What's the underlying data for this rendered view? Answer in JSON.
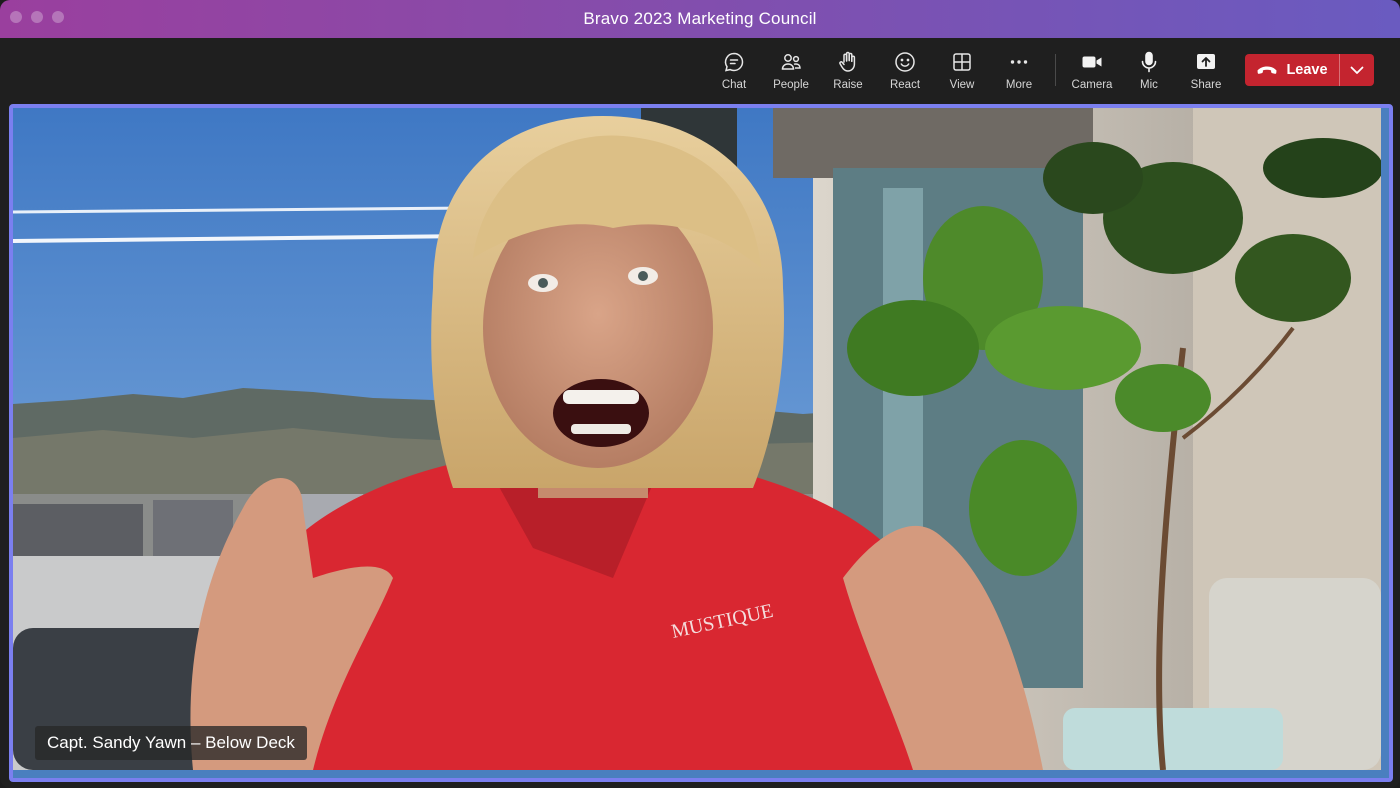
{
  "window": {
    "title": "Bravo 2023 Marketing Council"
  },
  "toolbar": {
    "buttons": [
      {
        "label": "Chat",
        "icon": "chat-icon"
      },
      {
        "label": "People",
        "icon": "people-icon"
      },
      {
        "label": "Raise",
        "icon": "raise-hand-icon"
      },
      {
        "label": "React",
        "icon": "smiley-icon"
      },
      {
        "label": "View",
        "icon": "grid-icon"
      },
      {
        "label": "More",
        "icon": "ellipsis-icon"
      },
      {
        "label": "Camera",
        "icon": "camera-icon"
      },
      {
        "label": "Mic",
        "icon": "microphone-icon"
      },
      {
        "label": "Share",
        "icon": "share-icon"
      }
    ],
    "leave": {
      "label": "Leave",
      "icon": "hang-up-icon",
      "color": "#c4242f"
    }
  },
  "video": {
    "participant_name": "Capt. Sandy Yawn – Below Deck",
    "shirt_logo": "MUSTIQUE",
    "active_speaker_border": "#7b7fef"
  },
  "colors": {
    "titlebar_start": "#9a3f9e",
    "titlebar_end": "#6a5bc0",
    "background": "#1f1f1f"
  }
}
